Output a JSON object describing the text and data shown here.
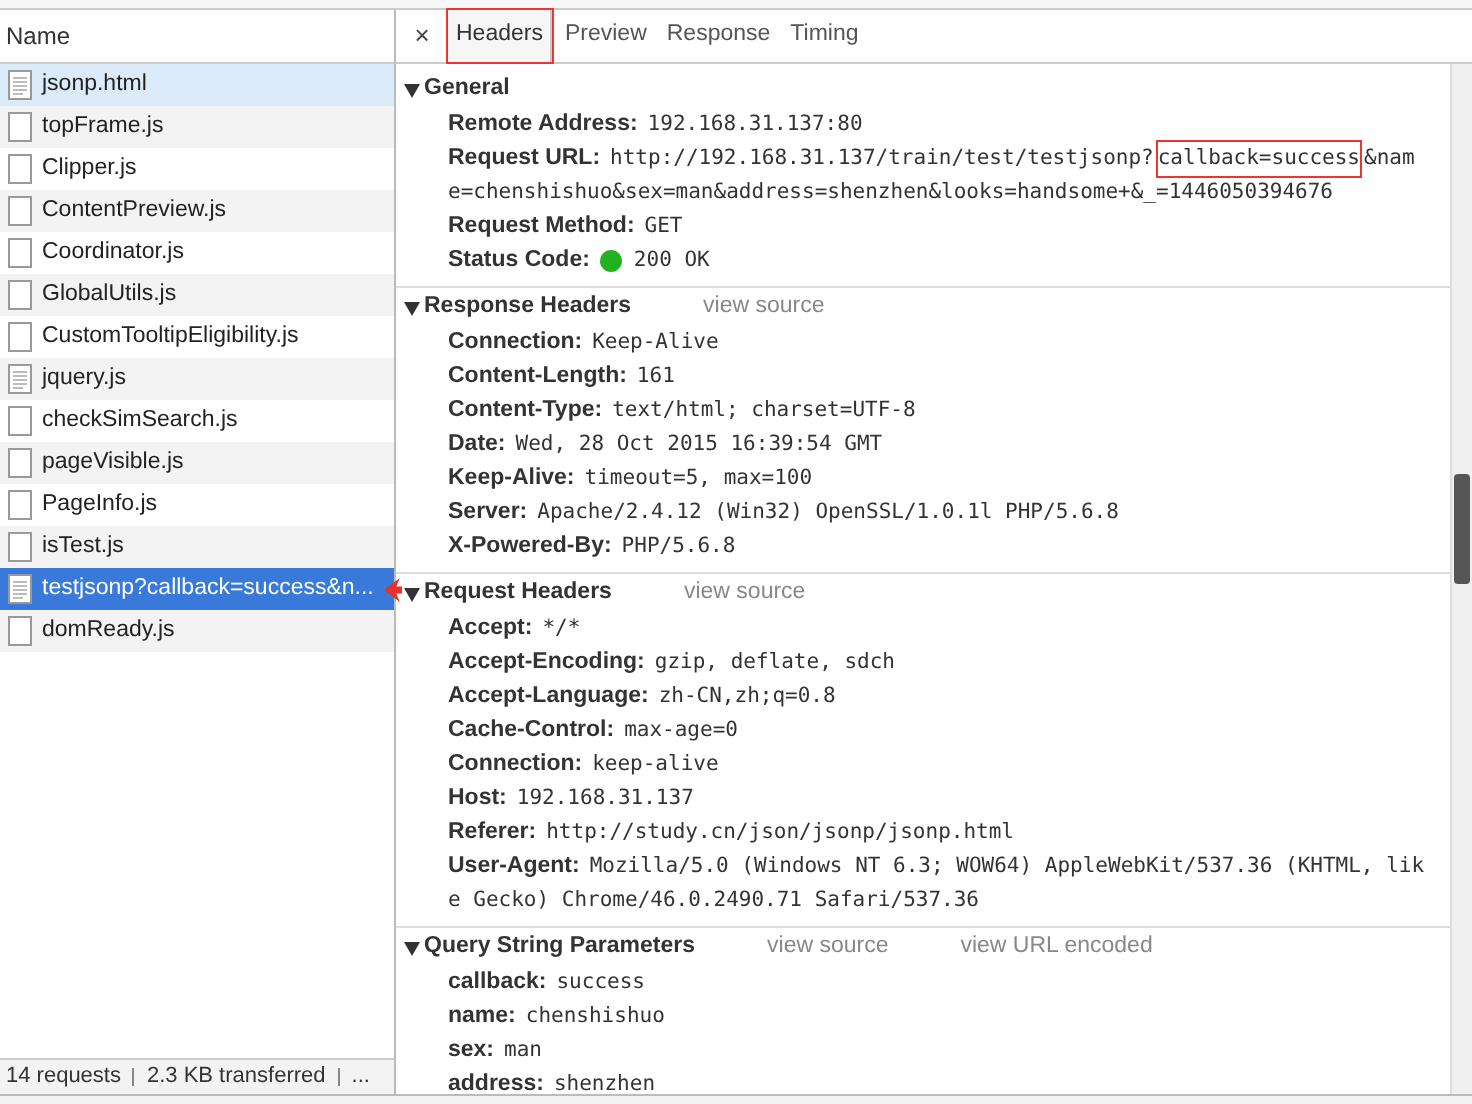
{
  "list": {
    "header": "Name",
    "rows": [
      {
        "name": "jsonp.html",
        "kind": "document",
        "selected": false,
        "hovered": true
      },
      {
        "name": "topFrame.js",
        "kind": "script",
        "selected": false,
        "hovered": false
      },
      {
        "name": "Clipper.js",
        "kind": "script",
        "selected": false,
        "hovered": false
      },
      {
        "name": "ContentPreview.js",
        "kind": "script",
        "selected": false,
        "hovered": false
      },
      {
        "name": "Coordinator.js",
        "kind": "script",
        "selected": false,
        "hovered": false
      },
      {
        "name": "GlobalUtils.js",
        "kind": "script",
        "selected": false,
        "hovered": false
      },
      {
        "name": "CustomTooltipEligibility.js",
        "kind": "script",
        "selected": false,
        "hovered": false
      },
      {
        "name": "jquery.js",
        "kind": "document",
        "selected": false,
        "hovered": false
      },
      {
        "name": "checkSimSearch.js",
        "kind": "script",
        "selected": false,
        "hovered": false
      },
      {
        "name": "pageVisible.js",
        "kind": "script",
        "selected": false,
        "hovered": false
      },
      {
        "name": "PageInfo.js",
        "kind": "script",
        "selected": false,
        "hovered": false
      },
      {
        "name": "isTest.js",
        "kind": "script",
        "selected": false,
        "hovered": false
      },
      {
        "name": "testjsonp?callback=success&n...",
        "kind": "document",
        "selected": true,
        "hovered": false
      },
      {
        "name": "domReady.js",
        "kind": "script",
        "selected": false,
        "hovered": false
      }
    ],
    "status": [
      "14 requests",
      "2.3 KB transferred",
      "..."
    ]
  },
  "detail": {
    "close": "×",
    "tabs": [
      {
        "label": "Headers",
        "selected": true,
        "boxed": true
      },
      {
        "label": "Preview",
        "selected": false,
        "boxed": false
      },
      {
        "label": "Response",
        "selected": false,
        "boxed": false
      },
      {
        "label": "Timing",
        "selected": false,
        "boxed": false
      }
    ],
    "sections": [
      {
        "title": "General",
        "expanded": true,
        "headers": [
          {
            "name": "Remote Address:",
            "value": "192.168.31.137:80"
          },
          {
            "name": "Request URL:",
            "segments": [
              {
                "text": "http://192.168.31.137/train/test/testjsonp?",
                "boxed": false
              },
              {
                "text": "callback=success",
                "boxed": true
              },
              {
                "text": "&nam",
                "boxed": false
              },
              {
                "text": "e=chenshishuo&sex=man&address=shenzhen&looks=handsome+&_=1446050394676",
                "boxed": false
              }
            ]
          },
          {
            "name": "Request Method:",
            "value": "GET"
          },
          {
            "name": "Status Code:",
            "value": "200 OK",
            "color": "#22b322"
          }
        ]
      },
      {
        "title": "Response Headers",
        "expanded": true,
        "links": [
          "view source"
        ],
        "headers": [
          {
            "name": "Connection:",
            "value": "Keep-Alive"
          },
          {
            "name": "Content-Length:",
            "value": "161"
          },
          {
            "name": "Content-Type:",
            "value": "text/html; charset=UTF-8"
          },
          {
            "name": "Date:",
            "value": "Wed, 28 Oct 2015 16:39:54 GMT"
          },
          {
            "name": "Keep-Alive:",
            "value": "timeout=5, max=100"
          },
          {
            "name": "Server:",
            "value": "Apache/2.4.12 (Win32) OpenSSL/1.0.1l PHP/5.6.8"
          },
          {
            "name": "X-Powered-By:",
            "value": "PHP/5.6.8"
          }
        ]
      },
      {
        "title": "Request Headers",
        "expanded": true,
        "links": [
          "view source"
        ],
        "headers": [
          {
            "name": "Accept:",
            "value": "*/*"
          },
          {
            "name": "Accept-Encoding:",
            "value": "gzip, deflate, sdch"
          },
          {
            "name": "Accept-Language:",
            "value": "zh-CN,zh;q=0.8"
          },
          {
            "name": "Cache-Control:",
            "value": "max-age=0"
          },
          {
            "name": "Connection:",
            "value": "keep-alive"
          },
          {
            "name": "Host:",
            "value": "192.168.31.137"
          },
          {
            "name": "Referer:",
            "value": "http://study.cn/json/jsonp/jsonp.html"
          },
          {
            "name": "User-Agent:",
            "value": "Mozilla/5.0 (Windows NT 6.3; WOW64) AppleWebKit/537.36 (KHTML, like Gecko) Chrome/46.0.2490.71 Safari/537.36"
          }
        ]
      },
      {
        "title": "Query String Parameters",
        "expanded": true,
        "links": [
          "view source",
          "view URL encoded"
        ],
        "headers": [
          {
            "name": "callback:",
            "value": "success"
          },
          {
            "name": "name:",
            "value": "chenshishuo"
          },
          {
            "name": "sex:",
            "value": "man"
          },
          {
            "name": "address:",
            "value": "shenzhen"
          }
        ]
      }
    ]
  }
}
